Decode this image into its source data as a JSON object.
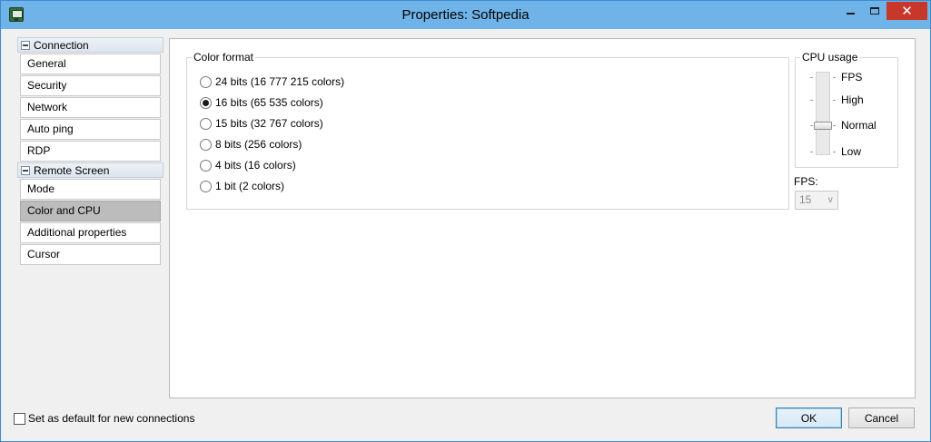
{
  "window": {
    "title": "Properties: Softpedia"
  },
  "titlebar_buttons": {
    "close": "✕"
  },
  "sidebar": {
    "groups": [
      {
        "label": "Connection",
        "items": [
          "General",
          "Security",
          "Network",
          "Auto ping",
          "RDP"
        ]
      },
      {
        "label": "Remote Screen",
        "items": [
          "Mode",
          "Color and CPU",
          "Additional properties",
          "Cursor"
        ]
      }
    ],
    "active_item": "Color and CPU"
  },
  "color_format": {
    "legend": "Color format",
    "options": [
      "24 bits (16 777 215 colors)",
      "16 bits (65 535 colors)",
      "15 bits (32 767 colors)",
      "8 bits (256 colors)",
      "4 bits (16 colors)",
      "1 bit (2 colors)"
    ],
    "selected": "16 bits (65 535 colors)"
  },
  "cpu_usage": {
    "legend": "CPU usage",
    "levels": [
      "FPS",
      "High",
      "Normal",
      "Low"
    ],
    "selected": "Normal"
  },
  "fps": {
    "label": "FPS:",
    "value": "15",
    "chevron": "∨"
  },
  "footer": {
    "default_label": "Set as default for new connections",
    "ok_label": "OK",
    "cancel_label": "Cancel"
  }
}
